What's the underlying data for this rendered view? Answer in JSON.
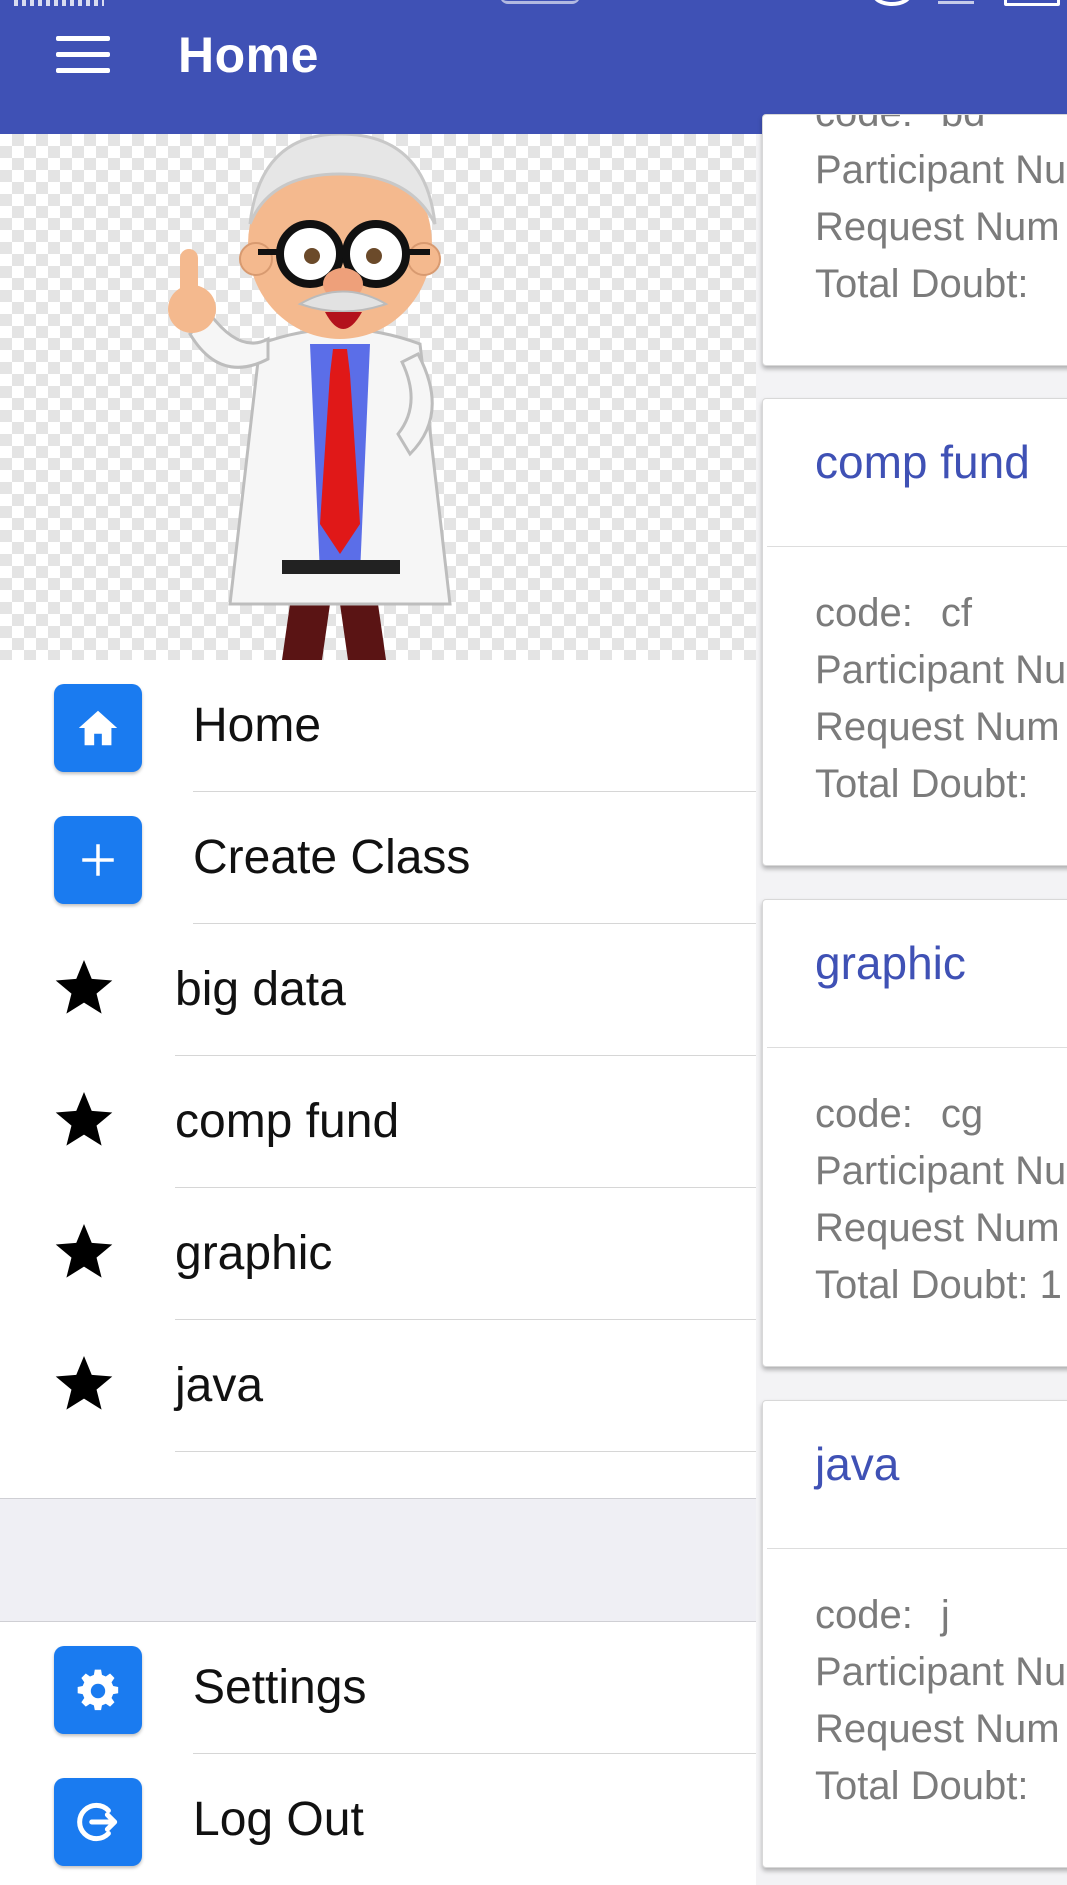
{
  "app_bar": {
    "title": "Home",
    "color": "#3f51b5",
    "menu_icon": "hamburger-menu-icon"
  },
  "drawer": {
    "header_image": "cartoon-professor-illustration",
    "menu_items": [
      {
        "label": "Home",
        "icon": "home-icon"
      },
      {
        "label": "Create Class",
        "icon": "plus-icon"
      }
    ],
    "classes": [
      {
        "label": "big data",
        "icon": "star-icon"
      },
      {
        "label": "comp fund",
        "icon": "star-icon"
      },
      {
        "label": "graphic",
        "icon": "star-icon"
      },
      {
        "label": "java",
        "icon": "star-icon"
      }
    ],
    "footer_items": [
      {
        "label": "Settings",
        "icon": "gear-icon"
      },
      {
        "label": "Log Out",
        "icon": "logout-icon"
      }
    ],
    "icon_box_color": "#1a7bf0"
  },
  "cards": [
    {
      "title": "",
      "code_label": "code:",
      "code_value": "bd",
      "participant": "Participant Nu",
      "request": "Request Num",
      "doubt": "Total Doubt:"
    },
    {
      "title": "comp fund",
      "code_label": "code:",
      "code_value": "cf",
      "participant": "Participant Nu",
      "request": "Request Num",
      "doubt": "Total Doubt:"
    },
    {
      "title": "graphic",
      "code_label": "code:",
      "code_value": "cg",
      "participant": "Participant Nu",
      "request": "Request Num",
      "doubt": "Total Doubt: 1"
    },
    {
      "title": "java",
      "code_label": "code:",
      "code_value": "j",
      "participant": "Participant Nu",
      "request": "Request Num",
      "doubt": "Total Doubt:"
    }
  ]
}
